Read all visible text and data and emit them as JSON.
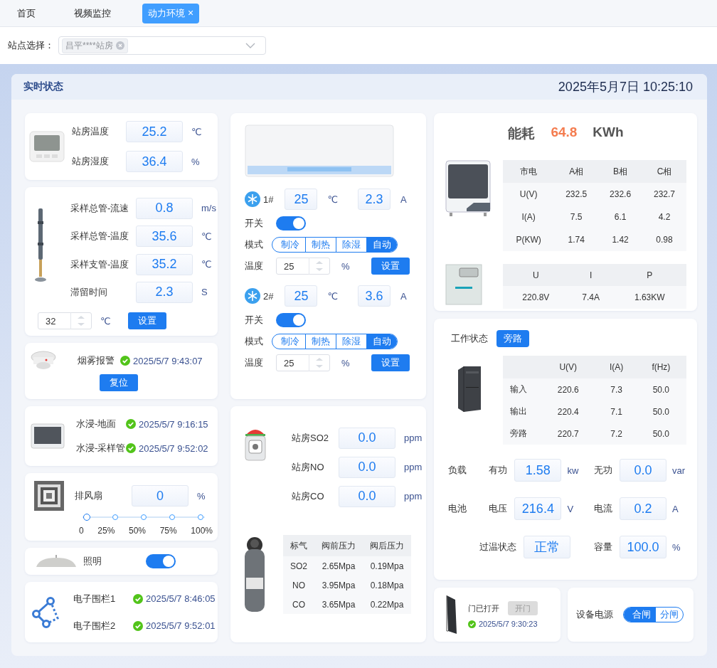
{
  "nav_tabs": [
    {
      "label": "首页",
      "selected": false
    },
    {
      "label": "视频监控",
      "selected": false
    },
    {
      "label": "动力环境",
      "selected": true,
      "close": "×"
    }
  ],
  "site_filter": {
    "label": "站点选择：",
    "tags": [
      "昌平****站房"
    ]
  },
  "panel": {
    "title": "实时状态",
    "datetime": "2025年5月7日 10:25:10"
  },
  "env": {
    "readings": [
      {
        "label": "站房温度",
        "value": "25.2",
        "unit": "℃"
      },
      {
        "label": "站房湿度",
        "value": "36.4",
        "unit": "%"
      }
    ]
  },
  "sampling": {
    "readings": [
      {
        "label": "采样总管-流速",
        "value": "0.8",
        "unit": "m/s"
      },
      {
        "label": "采样总管-温度",
        "value": "35.6",
        "unit": "℃"
      },
      {
        "label": "采样支管-温度",
        "value": "35.2",
        "unit": "℃"
      },
      {
        "label": "滞留时间",
        "value": "2.3",
        "unit": "S"
      }
    ],
    "setpoint": "32",
    "setpoint_unit": "℃",
    "button": "设置"
  },
  "smoke": {
    "label": "烟雾报警",
    "time": "2025/5/7 9:43:07",
    "ok": true,
    "button": "复位"
  },
  "water": {
    "items": [
      {
        "label": "水浸-地面",
        "time": "2025/5/7 9:16:15",
        "ok": true
      },
      {
        "label": "水浸-采样管",
        "time": "2025/5/7 9:52:02",
        "ok": true
      }
    ]
  },
  "fan": {
    "label": "排风扇",
    "value": "0",
    "unit": "%",
    "level": 0,
    "ticks": [
      "0",
      "25%",
      "50%",
      "75%",
      "100%"
    ]
  },
  "lighting": {
    "label": "照明",
    "on": true
  },
  "fence": {
    "items": [
      {
        "label": "电子围栏1",
        "time": "2025/5/7 8:46:05",
        "ok": true
      },
      {
        "label": "电子围栏2",
        "time": "2025/5/7 9:52:01",
        "ok": true
      }
    ]
  },
  "ac": {
    "units": [
      {
        "id": "1#",
        "temp": "25",
        "temp_unit": "℃",
        "current": "2.3",
        "current_unit": "A",
        "switch_label": "开关",
        "on": true,
        "mode_label": "模式",
        "modes": [
          {
            "label": "制冷",
            "selected": false
          },
          {
            "label": "制热",
            "selected": false
          },
          {
            "label": "除湿",
            "selected": false
          },
          {
            "label": "自动",
            "selected": true
          }
        ],
        "set_label": "温度",
        "set_value": "25",
        "set_unit": "%",
        "button": "设置"
      },
      {
        "id": "2#",
        "temp": "25",
        "temp_unit": "℃",
        "current": "3.6",
        "current_unit": "A",
        "switch_label": "开关",
        "on": true,
        "mode_label": "模式",
        "modes": [
          {
            "label": "制冷",
            "selected": false
          },
          {
            "label": "制热",
            "selected": false
          },
          {
            "label": "除湿",
            "selected": false
          },
          {
            "label": "自动",
            "selected": true
          }
        ],
        "set_label": "温度",
        "set_value": "25",
        "set_unit": "%",
        "button": "设置"
      }
    ]
  },
  "gas": {
    "readings": [
      {
        "label": "站房SO2",
        "value": "0.0",
        "unit": "ppm"
      },
      {
        "label": "站房NO",
        "value": "0.0",
        "unit": "ppm"
      },
      {
        "label": "站房CO",
        "value": "0.0",
        "unit": "ppm"
      }
    ],
    "table": {
      "columns": [
        "标气",
        "阀前压力",
        "阀后压力"
      ],
      "rows": [
        [
          "SO2",
          "2.65Mpa",
          "0.19Mpa"
        ],
        [
          "NO",
          "3.95Mpa",
          "0.18Mpa"
        ],
        [
          "CO",
          "3.65Mpa",
          "0.22Mpa"
        ]
      ]
    }
  },
  "energy": {
    "label": "能耗",
    "value": "64.8",
    "unit": "KWh",
    "mains_table": {
      "columns": [
        "市电",
        "A相",
        "B相",
        "C相"
      ],
      "rows": [
        [
          "U(V)",
          "232.5",
          "232.6",
          "232.7"
        ],
        [
          "I(A)",
          "7.5",
          "6.1",
          "4.2"
        ],
        [
          "P(KW)",
          "1.74",
          "1.42",
          "0.98"
        ]
      ]
    },
    "regulator_table": {
      "columns": [
        "U",
        "I",
        "P"
      ],
      "rows": [
        [
          "220.8V",
          "7.4A",
          "1.63KW"
        ]
      ]
    }
  },
  "ups": {
    "status_label": "工作状态",
    "status": "旁路",
    "columns": [
      "U(V)",
      "I(A)",
      "f(Hz)"
    ],
    "rows": [
      {
        "label": "输入",
        "values": [
          "220.6",
          "7.3",
          "50.0"
        ]
      },
      {
        "label": "输出",
        "values": [
          "220.4",
          "7.1",
          "50.0"
        ]
      },
      {
        "label": "旁路",
        "values": [
          "220.7",
          "7.2",
          "50.0"
        ]
      }
    ],
    "groups": [
      {
        "label": "负载",
        "fields": [
          {
            "label": "有功",
            "value": "1.58",
            "unit": "kw"
          },
          {
            "label": "无功",
            "value": "0.0",
            "unit": "var"
          }
        ]
      },
      {
        "label": "电池",
        "fields": [
          {
            "label": "电压",
            "value": "216.4",
            "unit": "V"
          },
          {
            "label": "电流",
            "value": "0.2",
            "unit": "A"
          }
        ]
      },
      {
        "fields": [
          {
            "label": "过温状态",
            "value": "正常"
          },
          {
            "label": "容量",
            "value": "100.0",
            "unit": "%"
          }
        ]
      }
    ]
  },
  "door": {
    "status": "门已打开",
    "button": "开门",
    "button_disabled": true,
    "time": "2025/5/7 9:30:23",
    "ok": true
  },
  "power": {
    "label": "设备电源",
    "options": [
      {
        "label": "合闸",
        "selected": true
      },
      {
        "label": "分闸",
        "selected": false
      }
    ]
  }
}
